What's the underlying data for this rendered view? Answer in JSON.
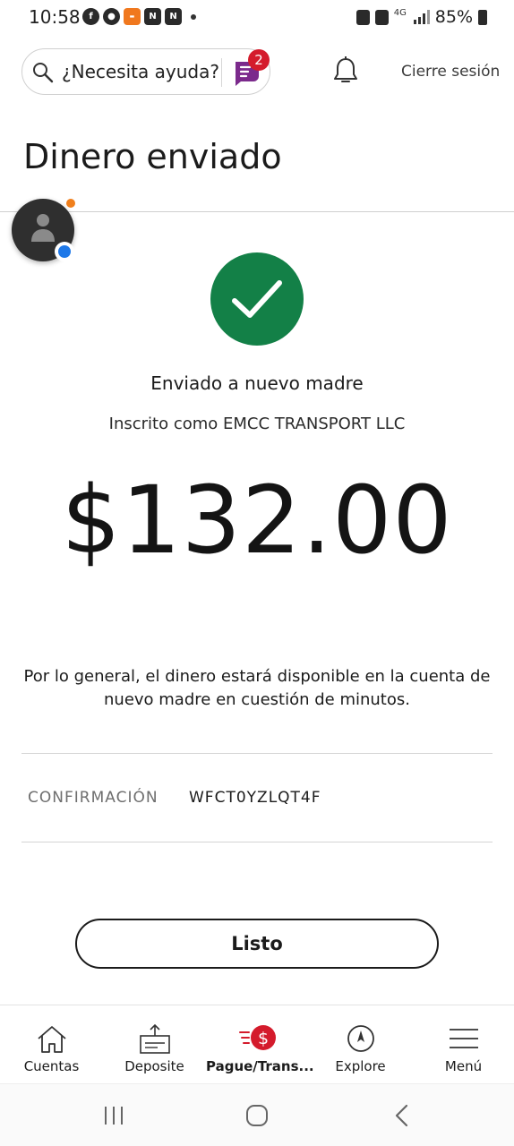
{
  "status_bar": {
    "time": "10:58",
    "battery": "85%",
    "network": "4G"
  },
  "header": {
    "search_placeholder": "¿Necesita ayuda?",
    "assistant_badge": "2",
    "sign_out": "Cierre sesión"
  },
  "page": {
    "title": "Dinero enviado"
  },
  "confirmation_card": {
    "sent_to": "Enviado a nuevo madre",
    "enrolled_as": "Inscrito como EMCC TRANSPORT LLC",
    "amount": "$132.00",
    "availability_note": "Por lo general, el dinero estará disponible en la cuenta de nuevo madre en cuestión de minutos.",
    "confirmation_label": "CONFIRMACIÓN",
    "confirmation_number": "WFCT0YZLQT4F",
    "done_button": "Listo"
  },
  "bottom_nav": {
    "items": [
      {
        "label": "Cuentas",
        "icon": "home-icon"
      },
      {
        "label": "Deposite",
        "icon": "deposit-icon"
      },
      {
        "label": "Pague/Trans...",
        "icon": "pay-transfer-icon",
        "active": true
      },
      {
        "label": "Explore",
        "icon": "compass-icon"
      },
      {
        "label": "Menú",
        "icon": "hamburger-menu-icon"
      }
    ]
  },
  "colors": {
    "success": "#138047",
    "badge": "#d41b2c",
    "pay_accent": "#d41b2c",
    "assistant": "#7b2a8c"
  }
}
